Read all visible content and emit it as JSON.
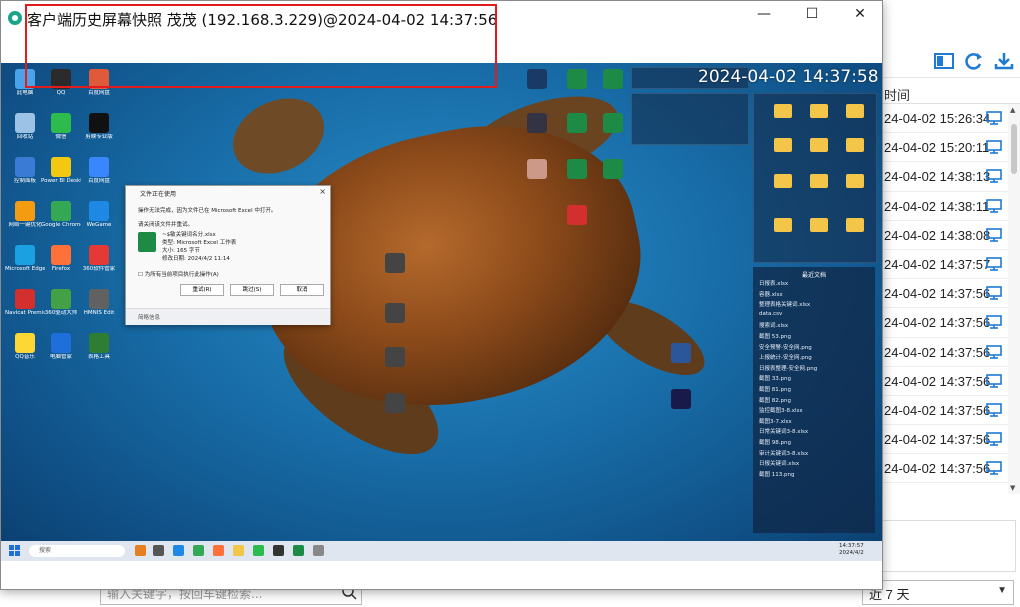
{
  "window": {
    "title": "客户端历史屏幕快照 茂茂 (192.168.3.229)@2024-04-02 14:37:56",
    "minimize": "—",
    "maximize": "☐",
    "close": "✕"
  },
  "snapshot": {
    "timestamp_overlay": "2024-04-02 14:37:58",
    "desktop_icons": [
      {
        "label": "此电脑",
        "color": "#4aa3e8"
      },
      {
        "label": "QQ",
        "color": "#2b2b2b"
      },
      {
        "label": "百度网盘",
        "color": "#e05a3a"
      },
      {
        "label": "回收站",
        "color": "#9cc3e6"
      },
      {
        "label": "微信",
        "color": "#2dbb4e"
      },
      {
        "label": "剪映专业版",
        "color": "#111111"
      },
      {
        "label": "控制面板",
        "color": "#3a7bd5"
      },
      {
        "label": "Power BI Desktop",
        "color": "#f2c811"
      },
      {
        "label": "百度网盘",
        "color": "#3a86ff"
      },
      {
        "label": "网络一键优化",
        "color": "#f39c12"
      },
      {
        "label": "Google Chrome",
        "color": "#34a853"
      },
      {
        "label": "WeGame",
        "color": "#1e88e5"
      },
      {
        "label": "Microsoft Edge",
        "color": "#1ba1e2"
      },
      {
        "label": "Firefox",
        "color": "#ff7139"
      },
      {
        "label": "360软件管家",
        "color": "#e53935"
      },
      {
        "label": "Navicat Premium 12",
        "color": "#d32f2f"
      },
      {
        "label": "360驱动大师",
        "color": "#43a047"
      },
      {
        "label": "HMNIS Edit",
        "color": "#616161"
      },
      {
        "label": "QQ音乐",
        "color": "#fdd835"
      },
      {
        "label": "电脑管家",
        "color": "#1e6fd9"
      },
      {
        "label": "表格工具",
        "color": "#2e7d32"
      }
    ],
    "dialog": {
      "title": "文件正在使用",
      "line1": "操作无法完成，因为文件已在 Microsoft Excel 中打开。",
      "line2": "请关闭该文件并重试。",
      "file_name": "~$敏关键词名分.xlsx",
      "file_type": "类型: Microsoft Excel 工作表",
      "file_size": "大小: 165 字节",
      "file_date": "修改日期: 2024/4/2 11:14",
      "checkbox": "为所有当前项目执行此操作(A)",
      "btn_retry": "重试(R)",
      "btn_skip": "跳过(S)",
      "btn_cancel": "取消",
      "footer": "简略信息"
    },
    "recent_panel": {
      "title": "最近文档",
      "items": [
        "日报表.xlsx",
        "容器.xlsx",
        "整理表格关键词.xlsx",
        "data.csv",
        "搜索词.xlsx",
        "截图 53.png",
        "安全预警-安全网.png",
        "上报统计-安全网.png",
        "日报表整理-安全网.png",
        "截图 33.png",
        "截图 81.png",
        "截图 82.png",
        "监控截图3-8.xlsx",
        "截图3-7.xlsx",
        "日常关键词3-8.xlsx",
        "截图 98.png",
        "审计关键词3-8.xlsx",
        "日报关键词.xlsx",
        "截图 113.png"
      ]
    },
    "taskbar": {
      "search_placeholder": "搜索",
      "clock_time": "14:37:57",
      "clock_date": "2024/4/2"
    }
  },
  "background_app": {
    "column_header": "时间",
    "rows": [
      "24-04-02 15:26:34",
      "24-04-02 15:20:11",
      "24-04-02 14:38:13",
      "24-04-02 14:38:11",
      "24-04-02 14:38:08",
      "24-04-02 14:37:57",
      "24-04-02 14:37:56",
      "24-04-02 14:37:56",
      "24-04-02 14:37:56",
      "24-04-02 14:37:56",
      "24-04-02 14:37:56",
      "24-04-02 14:37:56",
      "24-04-02 14:37:56"
    ],
    "search_placeholder": "输入关键字，按回车键检索...",
    "range_select": "近 7 天"
  },
  "colors": {
    "accent": "#1f7ad4",
    "highlight_border": "#e21c1c"
  }
}
